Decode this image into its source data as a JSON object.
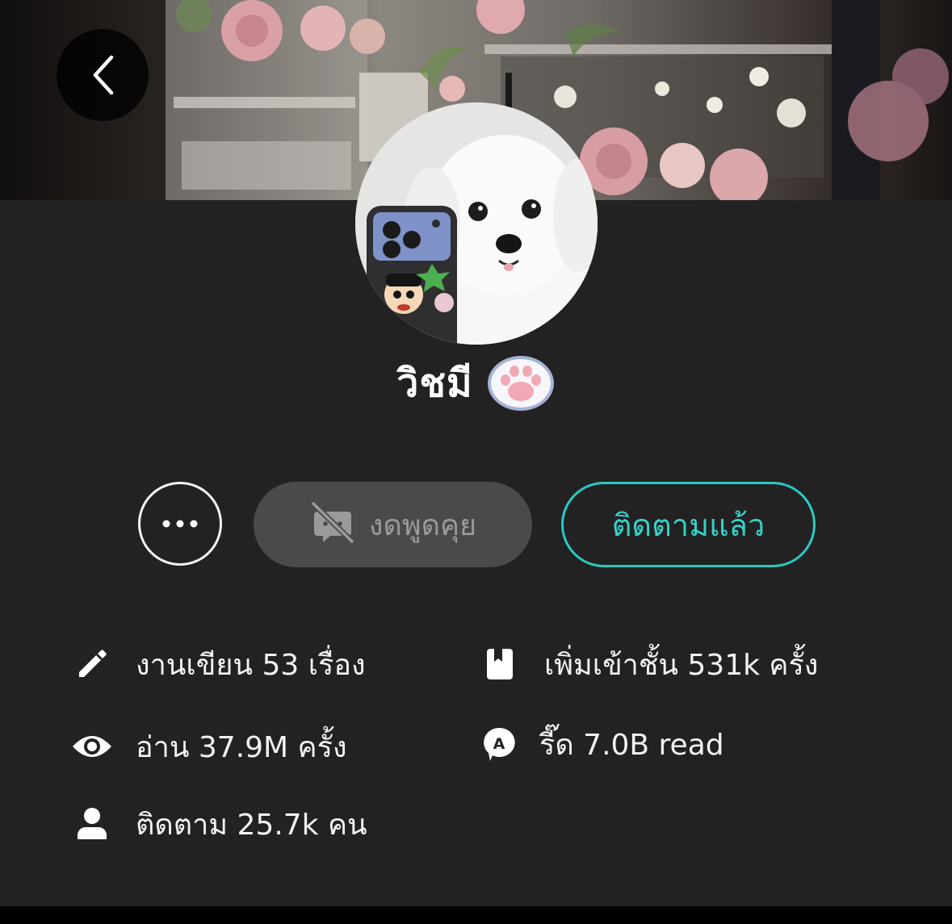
{
  "profile": {
    "display_name": "วิชมี"
  },
  "actions": {
    "more_label": "•••",
    "chat_label": "งดพูดคุย",
    "follow_label": "ติดตามแล้ว"
  },
  "stats": {
    "works": "งานเขียน 53 เรื่อง",
    "library_adds": "เพิ่มเข้าชั้น 531k ครั้ง",
    "reads": "อ่าน 37.9M ครั้ง",
    "read_coins": "รี๊ด 7.0B read",
    "followers": "ติดตาม 25.7k คน"
  },
  "icons": {
    "back": "chevron-left-icon",
    "more": "ellipsis-icon",
    "chat_disabled": "chat-off-icon",
    "works": "pencil-icon",
    "library": "bookmark-book-icon",
    "reads": "eye-icon",
    "read_coins": "speech-bubble-a-icon",
    "followers": "person-icon",
    "badge": "paw-icon"
  },
  "colors": {
    "background": "#222222",
    "accent": "#2cc8c0",
    "chat_button_bg": "#4a4a4a",
    "chat_button_text": "#9a9a9a",
    "text": "#f2f2f2"
  }
}
